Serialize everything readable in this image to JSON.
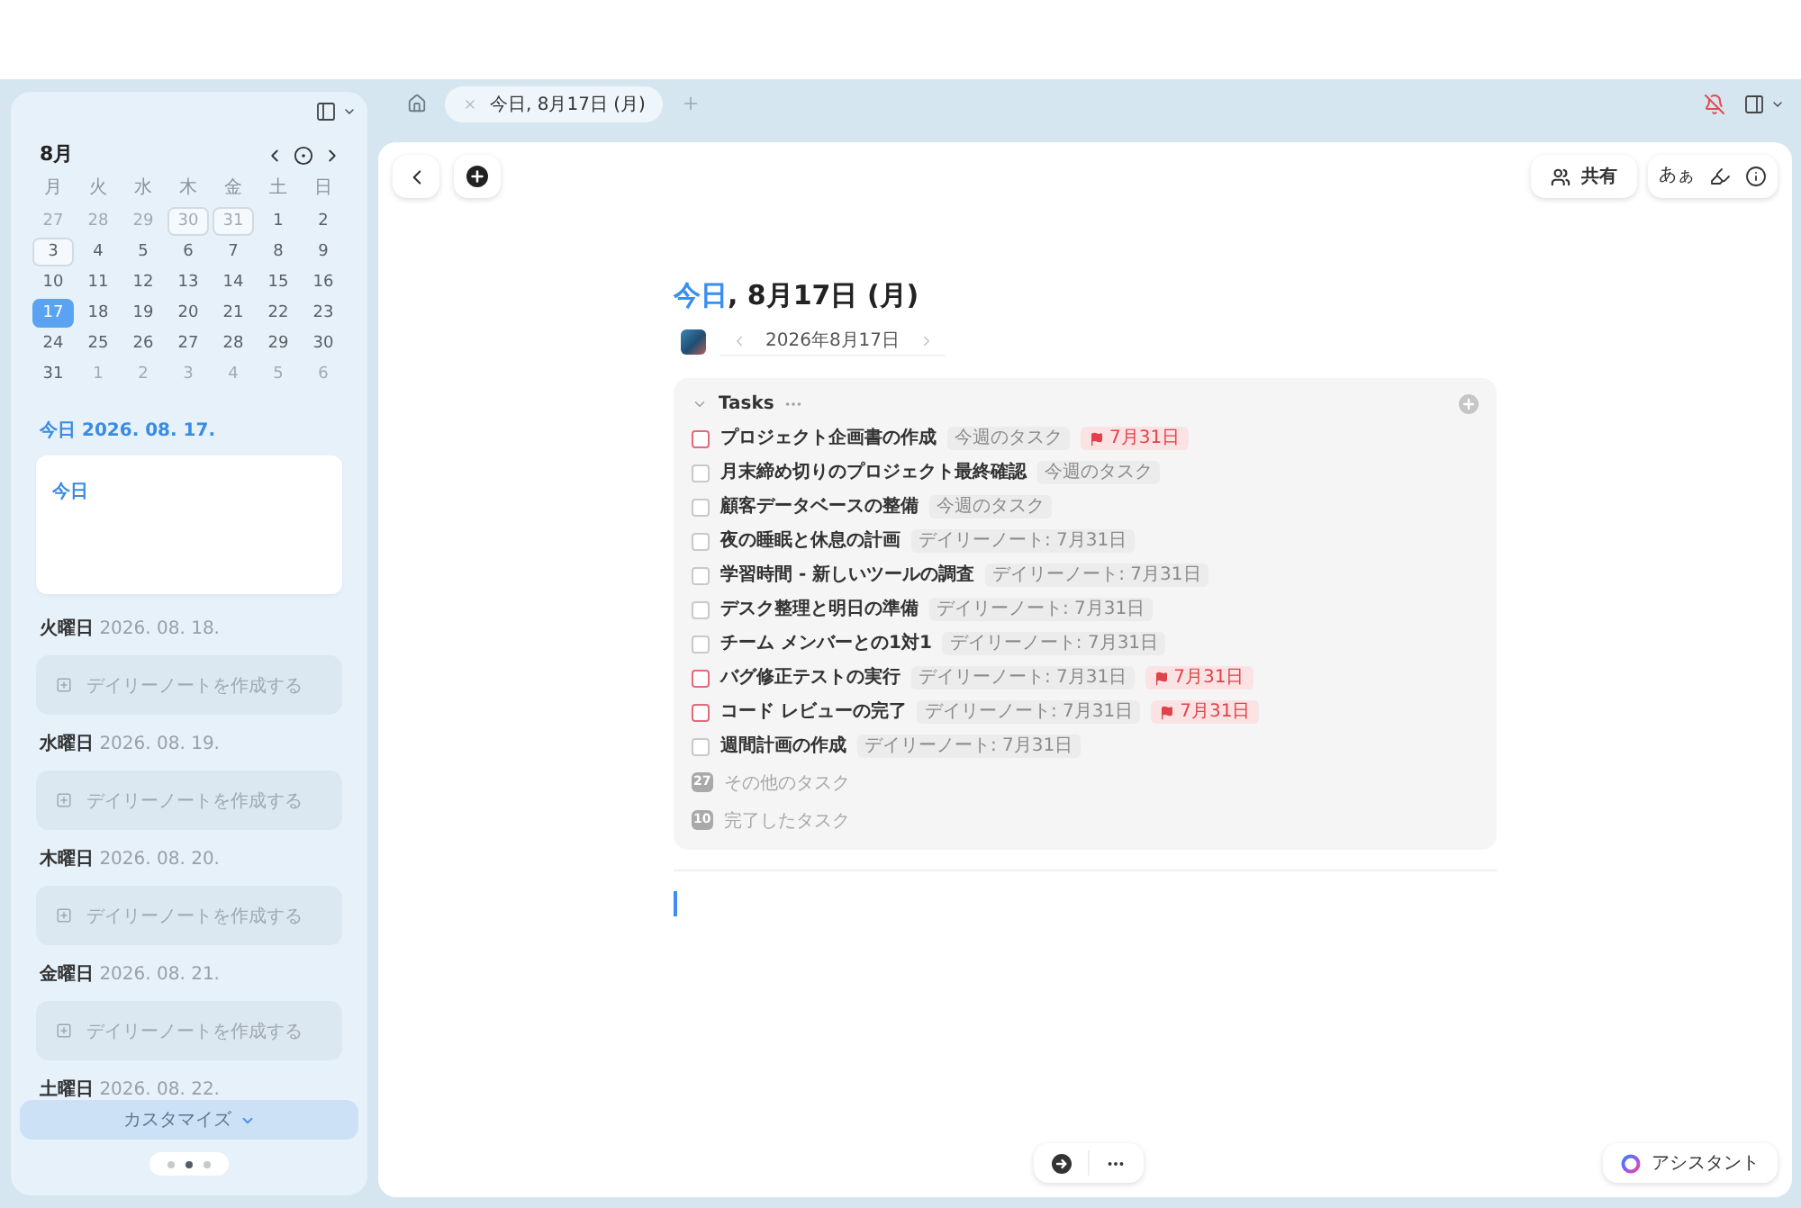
{
  "sidebar": {
    "calendar": {
      "month": "8月",
      "weekdays": [
        "月",
        "火",
        "水",
        "木",
        "金",
        "土",
        "日"
      ],
      "days": [
        {
          "day": "27",
          "outside": true,
          "marked": false,
          "selected": false
        },
        {
          "day": "28",
          "outside": true,
          "marked": false,
          "selected": false
        },
        {
          "day": "29",
          "outside": true,
          "marked": false,
          "selected": false
        },
        {
          "day": "30",
          "outside": true,
          "marked": true,
          "selected": false
        },
        {
          "day": "31",
          "outside": true,
          "marked": true,
          "selected": false
        },
        {
          "day": "1",
          "outside": false,
          "marked": false,
          "selected": false
        },
        {
          "day": "2",
          "outside": false,
          "marked": false,
          "selected": false
        },
        {
          "day": "3",
          "outside": false,
          "marked": true,
          "selected": false
        },
        {
          "day": "4",
          "outside": false,
          "marked": false,
          "selected": false
        },
        {
          "day": "5",
          "outside": false,
          "marked": false,
          "selected": false
        },
        {
          "day": "6",
          "outside": false,
          "marked": false,
          "selected": false
        },
        {
          "day": "7",
          "outside": false,
          "marked": false,
          "selected": false
        },
        {
          "day": "8",
          "outside": false,
          "marked": false,
          "selected": false
        },
        {
          "day": "9",
          "outside": false,
          "marked": false,
          "selected": false
        },
        {
          "day": "10",
          "outside": false,
          "marked": false,
          "selected": false
        },
        {
          "day": "11",
          "outside": false,
          "marked": false,
          "selected": false
        },
        {
          "day": "12",
          "outside": false,
          "marked": false,
          "selected": false
        },
        {
          "day": "13",
          "outside": false,
          "marked": false,
          "selected": false
        },
        {
          "day": "14",
          "outside": false,
          "marked": false,
          "selected": false
        },
        {
          "day": "15",
          "outside": false,
          "marked": false,
          "selected": false
        },
        {
          "day": "16",
          "outside": false,
          "marked": false,
          "selected": false
        },
        {
          "day": "17",
          "outside": false,
          "marked": false,
          "selected": true
        },
        {
          "day": "18",
          "outside": false,
          "marked": false,
          "selected": false
        },
        {
          "day": "19",
          "outside": false,
          "marked": false,
          "selected": false
        },
        {
          "day": "20",
          "outside": false,
          "marked": false,
          "selected": false
        },
        {
          "day": "21",
          "outside": false,
          "marked": false,
          "selected": false
        },
        {
          "day": "22",
          "outside": false,
          "marked": false,
          "selected": false
        },
        {
          "day": "23",
          "outside": false,
          "marked": false,
          "selected": false
        },
        {
          "day": "24",
          "outside": false,
          "marked": false,
          "selected": false
        },
        {
          "day": "25",
          "outside": false,
          "marked": false,
          "selected": false
        },
        {
          "day": "26",
          "outside": false,
          "marked": false,
          "selected": false
        },
        {
          "day": "27",
          "outside": false,
          "marked": false,
          "selected": false
        },
        {
          "day": "28",
          "outside": false,
          "marked": false,
          "selected": false
        },
        {
          "day": "29",
          "outside": false,
          "marked": false,
          "selected": false
        },
        {
          "day": "30",
          "outside": false,
          "marked": false,
          "selected": false
        },
        {
          "day": "31",
          "outside": false,
          "marked": false,
          "selected": false
        },
        {
          "day": "1",
          "outside": true,
          "marked": false,
          "selected": false
        },
        {
          "day": "2",
          "outside": true,
          "marked": false,
          "selected": false
        },
        {
          "day": "3",
          "outside": true,
          "marked": false,
          "selected": false
        },
        {
          "day": "4",
          "outside": true,
          "marked": false,
          "selected": false
        },
        {
          "day": "5",
          "outside": true,
          "marked": false,
          "selected": false
        },
        {
          "day": "6",
          "outside": true,
          "marked": false,
          "selected": false
        }
      ]
    },
    "today_heading": "今日 2026. 08. 17.",
    "today_card": {
      "title": "今日"
    },
    "upcoming": [
      {
        "weekday": "火曜日",
        "date": "2026. 08. 18.",
        "action": "デイリーノートを作成する"
      },
      {
        "weekday": "水曜日",
        "date": "2026. 08. 19.",
        "action": "デイリーノートを作成する"
      },
      {
        "weekday": "木曜日",
        "date": "2026. 08. 20.",
        "action": "デイリーノートを作成する"
      },
      {
        "weekday": "金曜日",
        "date": "2026. 08. 21.",
        "action": "デイリーノートを作成する"
      },
      {
        "weekday": "土曜日",
        "date": "2026. 08. 22."
      }
    ],
    "customize_button": "カスタマイズ",
    "pager": [
      {
        "selected": false
      },
      {
        "selected": true
      },
      {
        "selected": false
      }
    ]
  },
  "tab_bar": {
    "tabs": [
      {
        "label": "今日, 8月17日 (月)",
        "selected": true
      }
    ]
  },
  "toolbar": {
    "share_button": "共有",
    "font_button": "あぁ"
  },
  "page": {
    "title": {
      "highlight": "今日",
      "rest": ", 8月17日 (月)"
    },
    "date_nav": "2026年8月17日",
    "tasks": {
      "title": "Tasks",
      "items": [
        {
          "title": "プロジェクト企画書の作成",
          "tag": "今週のタスク",
          "checked": false,
          "due": "7月31日"
        },
        {
          "title": "月末締め切りのプロジェクト最終確認",
          "tag": "今週のタスク",
          "checked": false
        },
        {
          "title": "顧客データベースの整備",
          "tag": "今週のタスク",
          "checked": false
        },
        {
          "title": "夜の睡眠と休息の計画",
          "tag": "デイリーノート: 7月31日",
          "checked": false
        },
        {
          "title": "学習時間 - 新しいツールの調査",
          "tag": "デイリーノート: 7月31日",
          "checked": false
        },
        {
          "title": "デスク整理と明日の準備",
          "tag": "デイリーノート: 7月31日",
          "checked": false
        },
        {
          "title": "チーム メンバーとの1対1",
          "tag": "デイリーノート: 7月31日",
          "checked": false
        },
        {
          "title": "バグ修正テストの実行",
          "tag": "デイリーノート: 7月31日",
          "checked": false,
          "due": "7月31日"
        },
        {
          "title": "コード レビューの完了",
          "tag": "デイリーノート: 7月31日",
          "checked": false,
          "due": "7月31日"
        },
        {
          "title": "週間計画の作成",
          "tag": "デイリーノート: 7月31日",
          "checked": false
        }
      ],
      "summary": [
        {
          "count": "27",
          "label": "その他のタスク"
        },
        {
          "count": "10",
          "label": "完了したタスク"
        }
      ]
    }
  },
  "bottom_bar": {
    "assistant_button": "アシスタント"
  }
}
